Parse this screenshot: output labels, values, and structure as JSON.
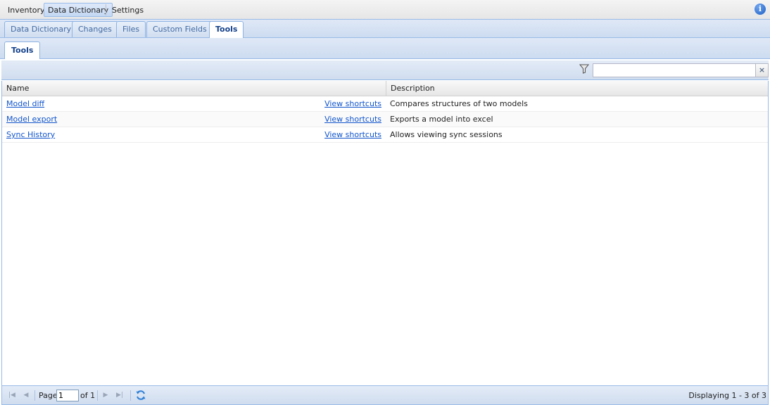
{
  "menu": {
    "items": [
      {
        "label": "Inventory"
      },
      {
        "label": "Data Dictionary",
        "active": true
      },
      {
        "label": "Settings"
      }
    ],
    "info_icon": "info-icon"
  },
  "tabs": [
    {
      "label": "Data Dictionary"
    },
    {
      "label": "Changes"
    },
    {
      "label": "Files"
    },
    {
      "label": "Custom Fields"
    },
    {
      "label": "Tools",
      "active": true
    }
  ],
  "subtabs": [
    {
      "label": "Tools",
      "active": true
    }
  ],
  "filter": {
    "icon": "filter-icon",
    "value": "",
    "placeholder": "",
    "clear_label": "×"
  },
  "grid": {
    "columns": [
      "Name",
      "Description"
    ],
    "rows": [
      {
        "name": "Model diff",
        "shortcuts": "View shortcuts",
        "description": "Compares structures of two models"
      },
      {
        "name": "Model export",
        "shortcuts": "View shortcuts",
        "description": "Exports a model into excel"
      },
      {
        "name": "Sync History",
        "shortcuts": "View shortcuts",
        "description": "Allows viewing sync sessions"
      }
    ]
  },
  "paging": {
    "page_label": "Page",
    "page_value": "1",
    "of_label": "of 1",
    "display_text": "Displaying 1 - 3 of 3"
  },
  "colors": {
    "accent": "#99bbe8",
    "link": "#1155cc",
    "active_tab_text": "#15428b"
  }
}
